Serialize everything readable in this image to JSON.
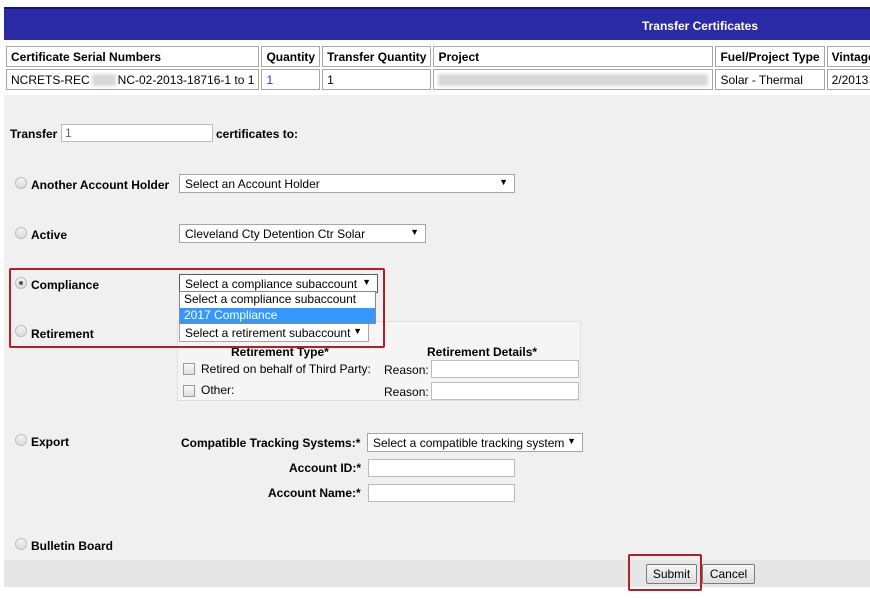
{
  "header": {
    "title": "Transfer Certificates"
  },
  "table": {
    "headers": [
      "Certificate Serial Numbers",
      "Quantity",
      "Transfer Quantity",
      "Project",
      "Fuel/Project Type",
      "Vintage"
    ],
    "row": {
      "serial_prefix": "NCRETS-REC",
      "serial_suffix": "NC-02-2013-18716-1 to 1",
      "quantity": "1",
      "transfer_quantity": "1",
      "fuel_type": "Solar - Thermal",
      "vintage": "2/2013"
    }
  },
  "transfer": {
    "label": "Transfer",
    "value": "1",
    "suffix": "certificates to:"
  },
  "options": {
    "account_holder": {
      "label": "Another Account Holder",
      "select": "Select an Account Holder"
    },
    "active": {
      "label": "Active",
      "select": "Cleveland Cty Detention Ctr Solar"
    },
    "compliance": {
      "label": "Compliance",
      "select": "Select a compliance subaccount",
      "list": [
        "Select a compliance subaccount",
        "2017 Compliance"
      ]
    },
    "retirement": {
      "label": "Retirement",
      "select": "Select a retirement subaccount",
      "type_header": "Retirement Type*",
      "details_header": "Retirement Details*",
      "third_party": "Retired on behalf of Third Party:",
      "other": "Other:",
      "reason": "Reason:"
    },
    "export": {
      "label": "Export",
      "tracking_label": "Compatible Tracking Systems:*",
      "tracking_select": "Select a compatible tracking system",
      "account_id_label": "Account ID:*",
      "account_name_label": "Account Name:*"
    },
    "bulletin": {
      "label": "Bulletin Board"
    }
  },
  "buttons": {
    "submit": "Submit",
    "cancel": "Cancel"
  },
  "colors": {
    "header_bg": "#2a2aa6",
    "highlight_red": "#b21f24",
    "selected_option": "#3399ff"
  }
}
